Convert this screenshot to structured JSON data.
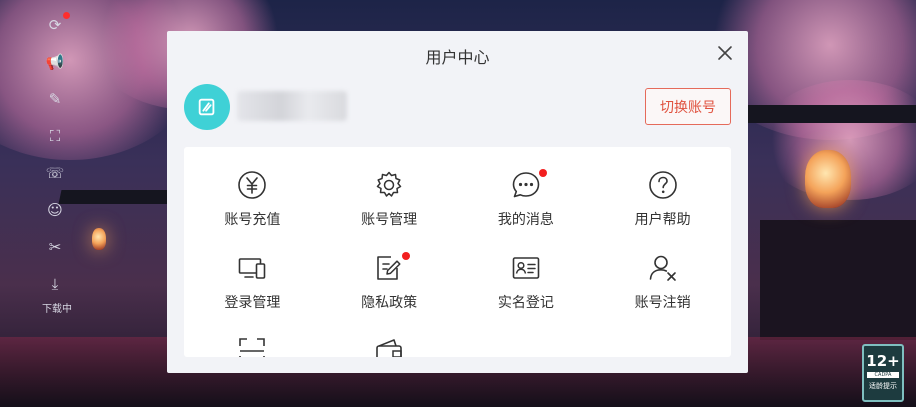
{
  "sidebar": {
    "download_label": "下载中"
  },
  "modal": {
    "title": "用户中心",
    "switch_account_label": "切换账号",
    "menu": [
      {
        "label": "账号充值",
        "icon": "yuan-icon"
      },
      {
        "label": "账号管理",
        "icon": "gear-icon"
      },
      {
        "label": "我的消息",
        "icon": "message-icon",
        "badge": true
      },
      {
        "label": "用户帮助",
        "icon": "help-icon"
      },
      {
        "label": "登录管理",
        "icon": "devices-icon"
      },
      {
        "label": "隐私政策",
        "icon": "privacy-icon",
        "badge": true
      },
      {
        "label": "实名登记",
        "icon": "id-card-icon"
      },
      {
        "label": "账号注销",
        "icon": "user-remove-icon"
      }
    ]
  },
  "age_rating": {
    "value": "12+",
    "org": "CADPA",
    "tip": "适龄提示"
  },
  "colors": {
    "accent": "#3fd1d6",
    "switch_button": "#e0523f",
    "badge": "#f21f1f"
  }
}
